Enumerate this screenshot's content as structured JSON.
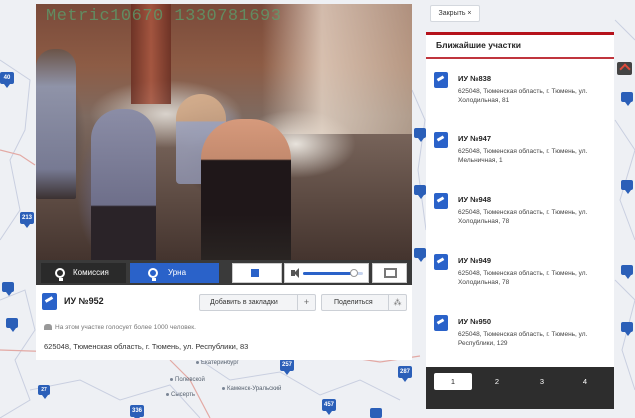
{
  "close_button": {
    "label": "Закрыть ×"
  },
  "video": {
    "watermark": "Metric10670 1330781693",
    "tabs": [
      {
        "label": "Комиссия",
        "icon": "camera-icon",
        "active": false
      },
      {
        "label": "Урна",
        "icon": "camera-icon",
        "active": true
      }
    ],
    "volume_level": 0.85
  },
  "station": {
    "title": "ИУ №952",
    "bookmark_label": "Добавить в закладки",
    "bookmark_plus": "+",
    "share_label": "Поделиться",
    "share_icon": "⁂",
    "voters_note": "На этом участке голосует более 1000 человек.",
    "address": "625048, Тюменская область, г. Тюмень, ул. Республики, 83"
  },
  "nearby": {
    "title": "Ближайшие участки",
    "items": [
      {
        "name": "ИУ №838",
        "address": "625048, Тюменская область, г. Тюмень, ул. Холодильная, 81"
      },
      {
        "name": "ИУ №947",
        "address": "625048, Тюменская область, г. Тюмень, ул. Мельничная, 1"
      },
      {
        "name": "ИУ №948",
        "address": "625048, Тюменская область, г. Тюмень, ул. Холодильная, 78"
      },
      {
        "name": "ИУ №949",
        "address": "625048, Тюменская область, г. Тюмень, ул. Холодильная, 78"
      },
      {
        "name": "ИУ №950",
        "address": "625048, Тюменская область, г. Тюмень, ул. Республики, 129"
      }
    ],
    "pages": [
      "1",
      "2",
      "3",
      "4"
    ],
    "active_page": "1"
  },
  "map": {
    "markers": [
      "40",
      "213",
      "257",
      "287",
      "336",
      "457",
      "27"
    ],
    "cities": [
      "Екатеринбург",
      "Полевской",
      "Каменск-Уральский",
      "Сысерть"
    ]
  },
  "colors": {
    "accent": "#2a62c9",
    "panel_accent": "#b5121b",
    "pager_bg": "#2d2d2d"
  }
}
